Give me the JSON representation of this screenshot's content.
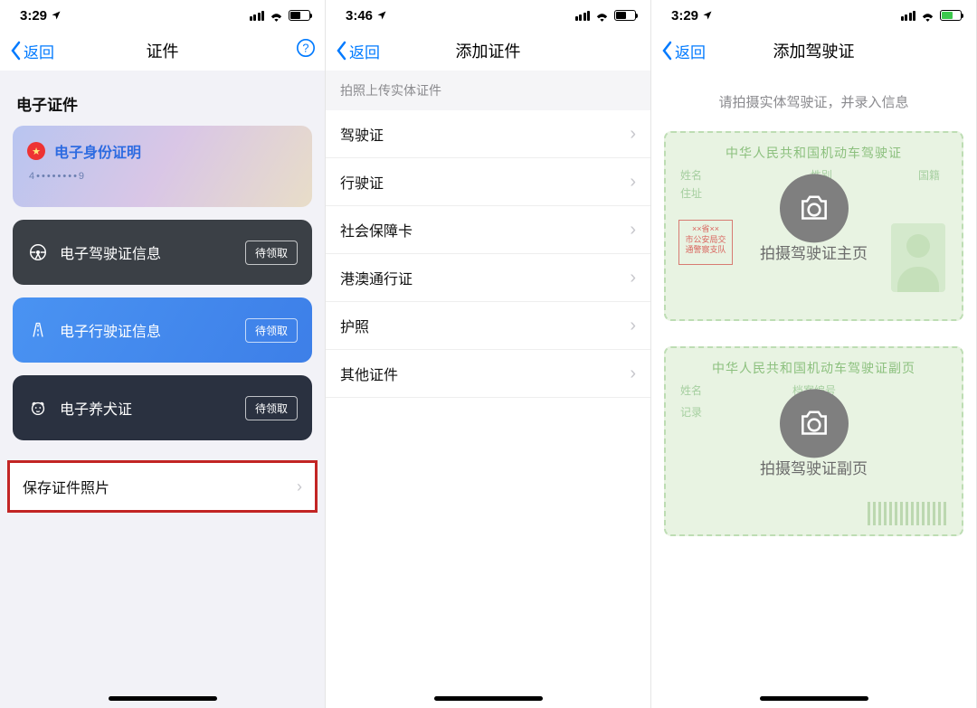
{
  "statusbar": {
    "time1": "3:29",
    "time2": "3:46",
    "time3": "3:29"
  },
  "nav": {
    "back": "返回",
    "title1": "证件",
    "title2": "添加证件",
    "title3": "添加驾驶证",
    "help": "?"
  },
  "screen1": {
    "section_header": "电子证件",
    "card_id": {
      "title": "电子身份证明",
      "number": "4••••••••9"
    },
    "card_drive": {
      "title": "电子驾驶证信息",
      "badge": "待领取"
    },
    "card_vehicle": {
      "title": "电子行驶证信息",
      "badge": "待领取"
    },
    "card_dog": {
      "title": "电子养犬证",
      "badge": "待领取"
    },
    "save_row": "保存证件照片"
  },
  "screen2": {
    "group_header": "拍照上传实体证件",
    "items": [
      "驾驶证",
      "行驶证",
      "社会保障卡",
      "港澳通行证",
      "护照",
      "其他证件"
    ]
  },
  "screen3": {
    "hint": "请拍摄实体驾驶证，并录入信息",
    "card_main": {
      "doc_title": "中华人民共和国机动车驾驶证",
      "name": "姓名",
      "sex": "性别",
      "nat": "国籍",
      "addr": "住址",
      "stamp_l1": "××省××",
      "stamp_l2": "市公安局交",
      "stamp_l3": "通警察支队",
      "cam_label": "拍摄驾驶证主页"
    },
    "card_sub": {
      "doc_title": "中华人民共和国机动车驾驶证副页",
      "name": "姓名",
      "file": "档案编号",
      "record": "记录",
      "cam_label": "拍摄驾驶证副页"
    }
  }
}
